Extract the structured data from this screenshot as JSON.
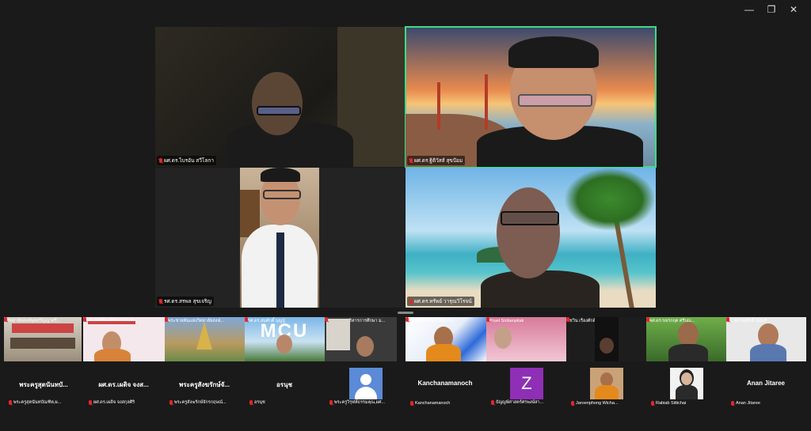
{
  "window": {
    "minimize": "—",
    "restore": "❐",
    "close": "✕"
  },
  "main": [
    {
      "name": "ผศ.ดร.ไบรอัน สวีโลกา",
      "active": false
    },
    {
      "name": "ผศ.ดร.ฐิติวัสส์ สุขป้อม",
      "active": true
    },
    {
      "name": "รศ.ดร.สรพล สุขเจริญ",
      "active": false
    },
    {
      "name": "ผศ.ดร.ทรัพย์ วารุณวิโรจน์",
      "active": false
    }
  ],
  "strip": [
    "วิทยาลัยสงฆ์พุทธปัญญาศรี...",
    "พระครูพิพัฒน์ปัญญาวิเทศ...",
    "พระชายพันแห่งวิทยาลัยสงฆ์...",
    "รศ.ดร.สมศักดิ์ บุญปู่",
    "ร.ม.พรหมบริหารการศึกษา ม...",
    "พระครูบัณฑิตย์ ศิริธรรม...",
    "Pruet Siribanpitak",
    "ชวิน เรืองศักดิ์",
    "ผศ.ดร.ขจรกฤต ศรีบุญ...",
    "1. ผศ.สมศักดิ์ น้อมศิ..."
  ],
  "strip_logo_text": "MCU",
  "row2": [
    {
      "display": "พระครูสุตนันทบั...",
      "label": "พระครูสุตนันทบัณฑิต,ผ..."
    },
    {
      "display": "ผศ.ดร.เผดิจ จงส...",
      "label": "ผศ.ดร.เผดิจ จงสกุลศิริ"
    },
    {
      "display": "พระครูสังฆรักษ์จั...",
      "label": "พระครูสังฆรักษ์จักรกฤษณ์..."
    },
    {
      "display": "อรนุช",
      "label": "อรนุช"
    },
    {
      "display": "",
      "label": "พระครูวิรุฬห์ธรรมคุณ,ผศ..."
    },
    {
      "display": "Kanchanamanoch",
      "label": "Kanchanamanoch"
    },
    {
      "display": "Z",
      "label": "ธัญญพ์ศาสตร์ศรพงษ์สา..."
    },
    {
      "display": "",
      "label": "Jaroenphong Wicha..."
    },
    {
      "display": "",
      "label": "Rabiab Sittichai"
    },
    {
      "display": "Anan Jitaree",
      "label": "Anan Jitaree"
    }
  ],
  "colors": {
    "active_border": "#3ddc84",
    "muted_mic": "#e0282b",
    "z_avatar": "#8e2fb5",
    "person_avatar": "#5b8ad6"
  }
}
